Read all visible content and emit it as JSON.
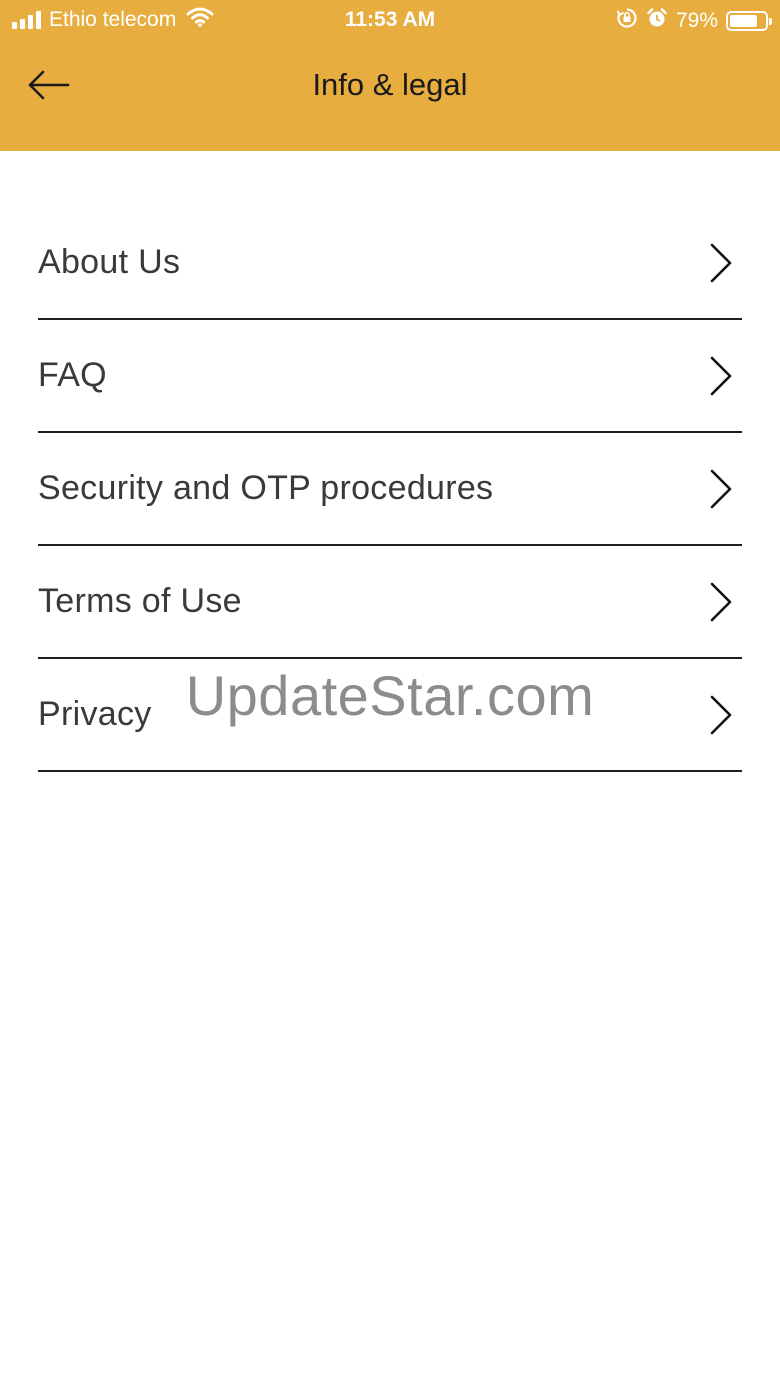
{
  "status_bar": {
    "carrier": "Ethio telecom",
    "time": "11:53 AM",
    "battery_percent": "79%",
    "battery_level": 0.79,
    "signal_bars": 4,
    "icons": [
      "signal-icon",
      "wifi-icon",
      "orientation-lock-icon",
      "alarm-icon",
      "battery-icon"
    ]
  },
  "header": {
    "title": "Info & legal",
    "back_icon": "arrow-left-icon"
  },
  "menu": {
    "items": [
      {
        "label": "About Us",
        "icon": "chevron-right-icon"
      },
      {
        "label": "FAQ",
        "icon": "chevron-right-icon"
      },
      {
        "label": "Security and OTP procedures",
        "icon": "chevron-right-icon"
      },
      {
        "label": "Terms of Use",
        "icon": "chevron-right-icon"
      },
      {
        "label": "Privacy",
        "icon": "chevron-right-icon"
      }
    ]
  },
  "watermark": {
    "text": "UpdateStar.com"
  },
  "colors": {
    "header_bg": "#e7ad3e",
    "background": "#ffffff",
    "divider": "#1e1e1e",
    "label_text": "#3a3a3a"
  }
}
